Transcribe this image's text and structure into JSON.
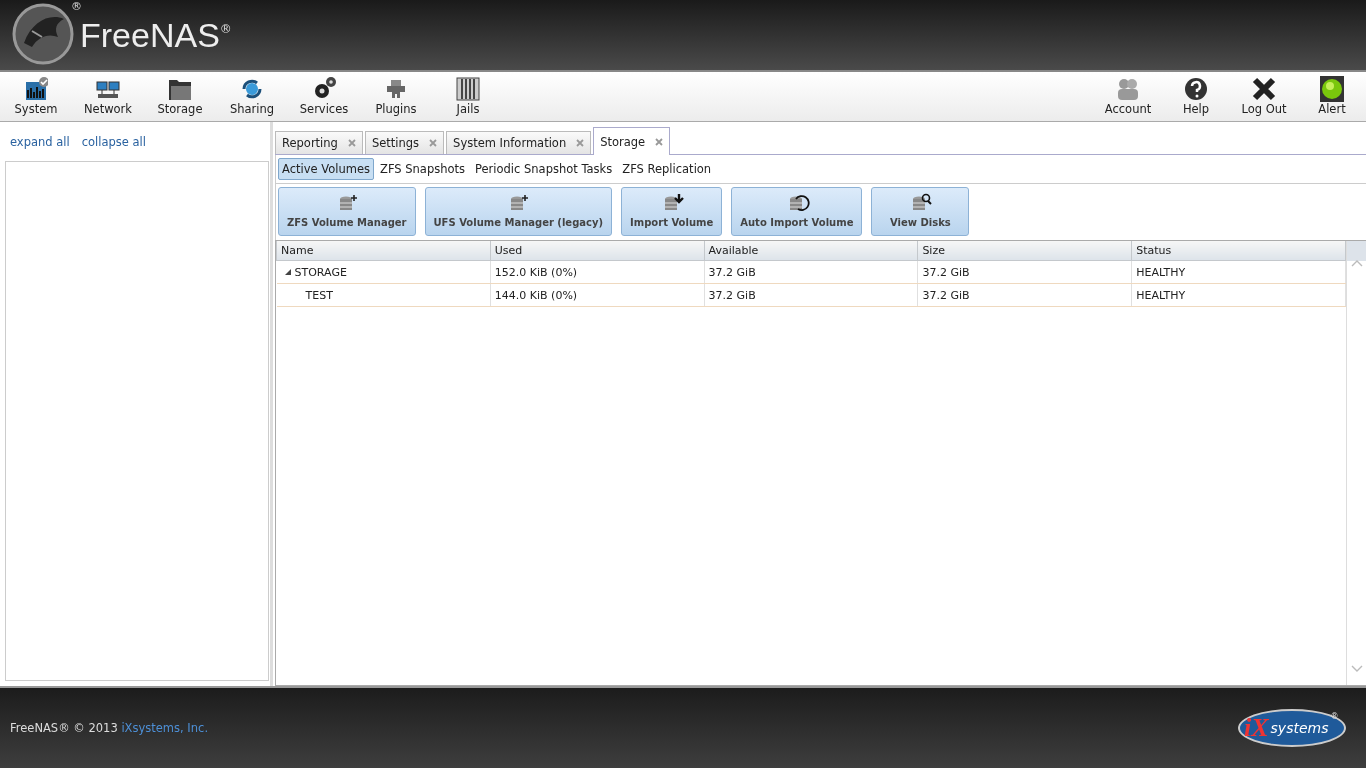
{
  "header": {
    "logo": "FreeNAS",
    "logo_mark": "®",
    "emblem_mark": "®"
  },
  "nav": {
    "left": [
      {
        "label": "System",
        "kind": "system"
      },
      {
        "label": "Network",
        "kind": "network"
      },
      {
        "label": "Storage",
        "kind": "storage"
      },
      {
        "label": "Sharing",
        "kind": "sharing"
      },
      {
        "label": "Services",
        "kind": "services"
      },
      {
        "label": "Plugins",
        "kind": "plugins"
      },
      {
        "label": "Jails",
        "kind": "jails"
      }
    ],
    "right": [
      {
        "label": "Account",
        "kind": "account"
      },
      {
        "label": "Help",
        "kind": "help"
      },
      {
        "label": "Log Out",
        "kind": "logout"
      },
      {
        "label": "Alert",
        "kind": "alert"
      }
    ]
  },
  "sidebar": {
    "links": [
      "expand all",
      "collapse all"
    ]
  },
  "tabs": [
    {
      "label": "Reporting",
      "selected": false
    },
    {
      "label": "Settings",
      "selected": false
    },
    {
      "label": "System Information",
      "selected": false
    },
    {
      "label": "Storage",
      "selected": true
    }
  ],
  "subtabs": [
    {
      "label": "Active Volumes",
      "selected": true
    },
    {
      "label": "ZFS Snapshots",
      "selected": false
    },
    {
      "label": "Periodic Snapshot Tasks",
      "selected": false
    },
    {
      "label": "ZFS Replication",
      "selected": false
    }
  ],
  "buttons": [
    {
      "label": "ZFS Volume Manager",
      "kind": "add"
    },
    {
      "label": "UFS Volume Manager (legacy)",
      "kind": "add"
    },
    {
      "label": "Import Volume",
      "kind": "import"
    },
    {
      "label": "Auto Import Volume",
      "kind": "auto"
    },
    {
      "label": "View Disks",
      "kind": "view"
    }
  ],
  "table": {
    "columns": [
      "Name",
      "Used",
      "Available",
      "Size",
      "Status"
    ],
    "rows": [
      {
        "cells": [
          "STORAGE",
          "152.0 KiB (0%)",
          "37.2 GiB",
          "37.2 GiB",
          "HEALTHY"
        ],
        "expanded": true,
        "children": [
          {
            "cells": [
              "TEST",
              "144.0 KiB (0%)",
              "37.2 GiB",
              "37.2 GiB",
              "HEALTHY"
            ]
          }
        ]
      }
    ]
  },
  "footer": {
    "text": "FreeNAS® © 2013",
    "link": "iXsystems, Inc.",
    "logo_mark": "iX",
    "logo_text": "systems",
    "logo_reg": "®"
  }
}
